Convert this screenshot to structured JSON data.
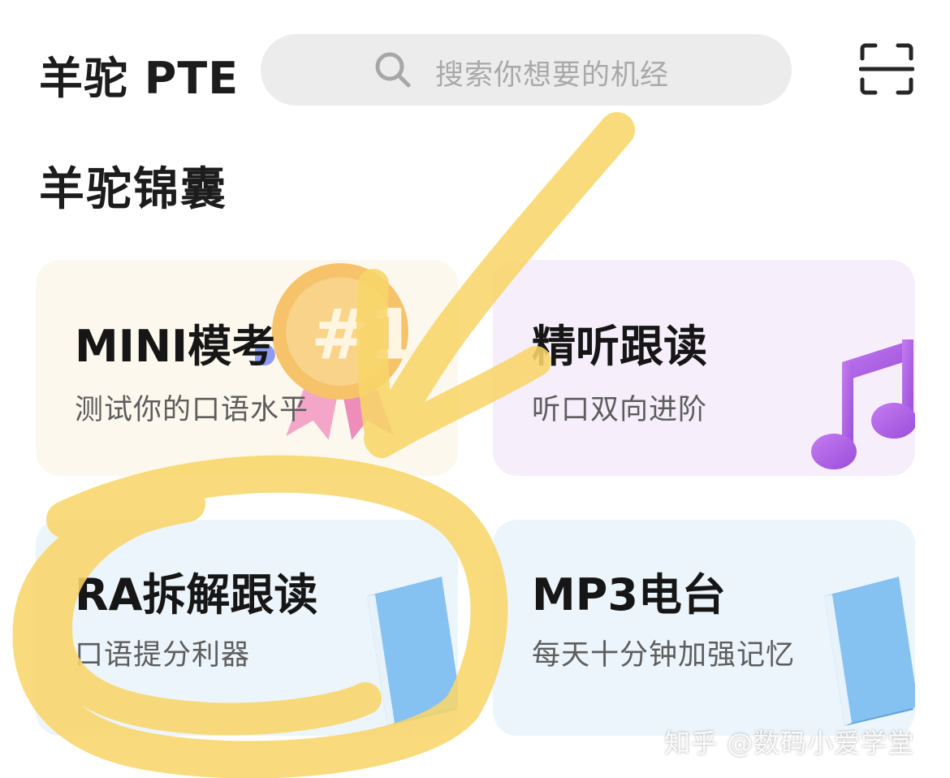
{
  "header": {
    "app_title": "羊驼 PTE",
    "search_placeholder": "搜索你想要的机经",
    "search_icon": "search-icon",
    "scan_icon": "scan-icon"
  },
  "section_title": "羊驼锦囊",
  "cards": [
    {
      "title": "MINI模考",
      "subtitle": "测试你的口语水平",
      "icon": "medal-first-place-icon"
    },
    {
      "title": "精听跟读",
      "subtitle": "听口双向进阶",
      "icon": "music-note-icon"
    },
    {
      "title": "RA拆解跟读",
      "subtitle": "口语提分利器",
      "icon": "book-icon"
    },
    {
      "title": "MP3电台",
      "subtitle": "每天十分钟加强记忆",
      "icon": "book-icon"
    }
  ],
  "watermark": "知乎 @数码小爱学堂",
  "colors": {
    "annotation": "#f9d66a",
    "card_mini": "#fdf8ee",
    "card_listen": "#f6eefb",
    "card_ra": "#ecf5fb",
    "card_mp3": "#ecf5fb"
  }
}
